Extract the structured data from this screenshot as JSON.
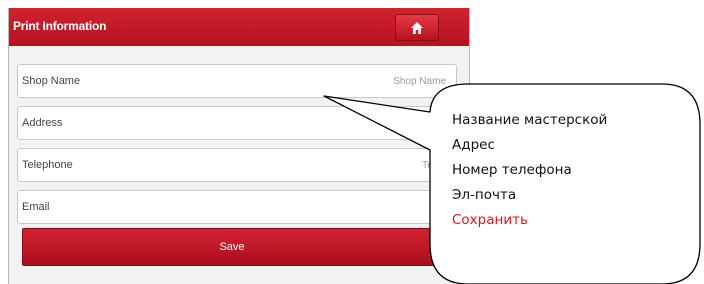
{
  "header": {
    "title": "Print Information",
    "home_icon": "home-icon"
  },
  "fields": [
    {
      "label": "Shop Name",
      "placeholder": "Shop Name"
    },
    {
      "label": "Address",
      "placeholder": ""
    },
    {
      "label": "Telephone",
      "placeholder": "Telep"
    },
    {
      "label": "Email",
      "placeholder": "E"
    }
  ],
  "save_label": "Save",
  "callout": {
    "lines": [
      "Название мастерской",
      "Адрес",
      "Номер телефона",
      "Эл-почта"
    ],
    "highlight": "Сохранить",
    "highlight_color": "#e0141c"
  },
  "colors": {
    "accent": "#c41a26"
  }
}
